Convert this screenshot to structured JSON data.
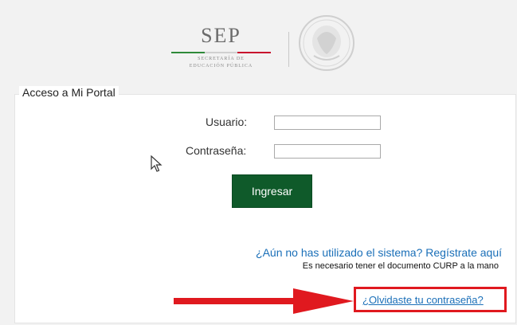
{
  "header": {
    "logo_text": "SEP",
    "logo_subtitle_line1": "SECRETARÍA DE",
    "logo_subtitle_line2": "EDUCACIÓN PÚBLICA",
    "stripe_colors": [
      "#2f8a3a",
      "#d0d0d0",
      "#c8102e"
    ],
    "seal_icon": "mexico-coat-of-arms-seal-icon"
  },
  "portal": {
    "legend": "Acceso a Mi Portal",
    "usuario_label": "Usuario:",
    "usuario_value": "",
    "password_label": "Contraseña:",
    "password_value": "",
    "submit_label": "Ingresar",
    "register_link": "¿Aún no has utilizado el sistema? Regístrate aquí",
    "curp_note": "Es necesario tener el documento CURP a la mano",
    "forgot_link": "¿Olvidaste tu contraseña?"
  },
  "colors": {
    "button_green": "#0f5a2a",
    "link_blue": "#1a6fb8",
    "highlight_red": "#e0191f"
  },
  "overlay": {
    "cursor_icon": "mouse-pointer-icon",
    "arrow_icon": "red-arrow-icon"
  }
}
